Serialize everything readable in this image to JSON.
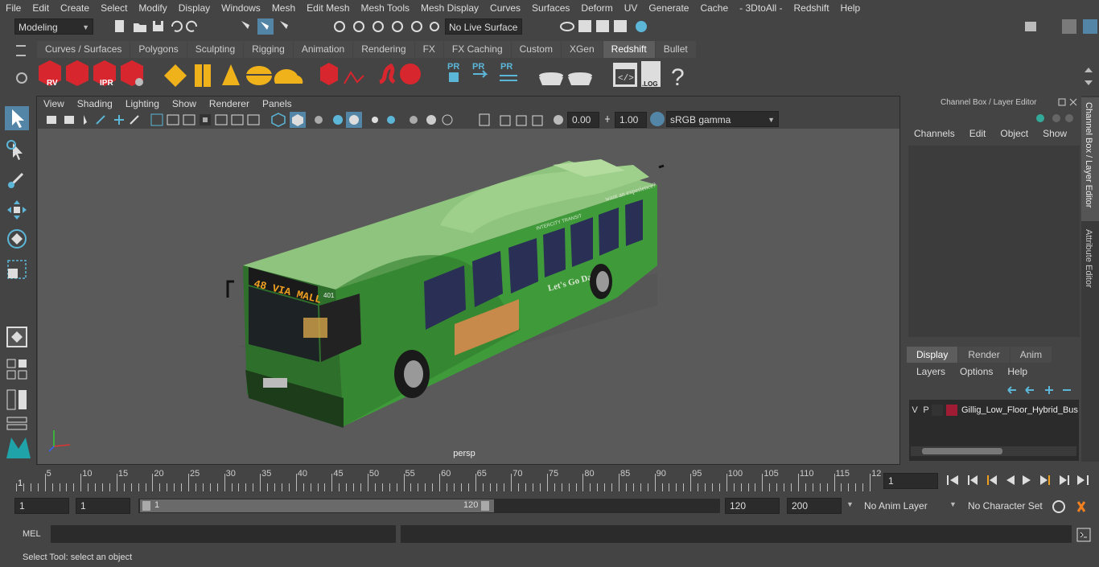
{
  "menu": [
    "File",
    "Edit",
    "Create",
    "Select",
    "Modify",
    "Display",
    "Windows",
    "Mesh",
    "Edit Mesh",
    "Mesh Tools",
    "Mesh Display",
    "Curves",
    "Surfaces",
    "Deform",
    "UV",
    "Generate",
    "Cache",
    "- 3DtoAll -",
    "Redshift",
    "Help"
  ],
  "status": {
    "mode": "Modeling",
    "live_surface": "No Live Surface"
  },
  "shelf_tabs": [
    "Curves / Surfaces",
    "Polygons",
    "Sculpting",
    "Rigging",
    "Animation",
    "Rendering",
    "FX",
    "FX Caching",
    "Custom",
    "XGen",
    "Redshift",
    "Bullet"
  ],
  "shelf_active": "Redshift",
  "shelf_icons": {
    "rv": "RV",
    "ipr": "IPR",
    "pr": "PR",
    "log": ".LOG",
    "help": "?"
  },
  "viewport": {
    "menu": [
      "View",
      "Shading",
      "Lighting",
      "Show",
      "Renderer",
      "Panels"
    ],
    "exposure": "0.00",
    "gamma": "1.00",
    "colorspace": "sRGB gamma",
    "camera_label": "persp",
    "bus_sign": "48 VIA MALL",
    "bus_number": "401",
    "bus_side_text": "Let's Go Dash",
    "bus_slogan": "want an experience?",
    "bus_brand": "INTERCITY TRANSIT"
  },
  "channel_box": {
    "title": "Channel Box / Layer Editor",
    "menu": [
      "Channels",
      "Edit",
      "Object",
      "Show"
    ],
    "layer_tabs": [
      "Display",
      "Render",
      "Anim"
    ],
    "layer_tab_active": "Display",
    "layer_menu": [
      "Layers",
      "Options",
      "Help"
    ],
    "layer": {
      "v": "V",
      "p": "P",
      "name": "Gillig_Low_Floor_Hybrid_Bus",
      "color": "#a01c34"
    }
  },
  "side_tabs": [
    "Channel Box / Layer Editor",
    "Attribute Editor"
  ],
  "timeline": {
    "ticks": [
      "5",
      "10",
      "15",
      "20",
      "25",
      "30",
      "35",
      "40",
      "45",
      "50",
      "55",
      "60",
      "65",
      "70",
      "75",
      "80",
      "85",
      "90",
      "95",
      "100",
      "105",
      "110",
      "115",
      "12"
    ],
    "start_marker": "1",
    "current_frame": "1"
  },
  "range": {
    "start": "1",
    "playback_start": "1",
    "slider_start": "1",
    "slider_end": "120",
    "playback_end": "120",
    "end": "200",
    "anim_layer": "No Anim Layer",
    "character_set": "No Character Set"
  },
  "command": {
    "label": "MEL"
  },
  "help_line": "Select Tool: select an object",
  "colors": {
    "bg": "#444444",
    "viewport": "#5a5a5a",
    "accent": "#5285a6",
    "bus_green": "#3f9a3a"
  }
}
